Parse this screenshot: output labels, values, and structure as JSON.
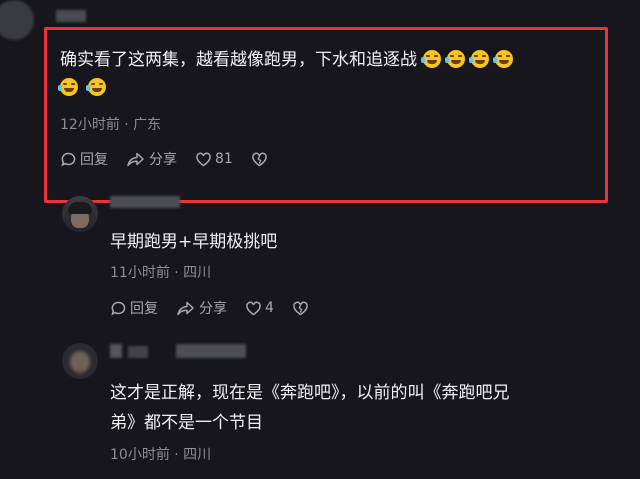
{
  "comments": [
    {
      "text_line1": "确实看了这两集，越看越像跑男，下水和追逐战",
      "meta": "12小时前 · 广东",
      "reply_label": "回复",
      "share_label": "分享",
      "like_count": "81",
      "emoji_count": 6
    },
    {
      "text": "早期跑男+早期极挑吧",
      "meta": "11小时前 · 四川",
      "reply_label": "回复",
      "share_label": "分享",
      "like_count": "4"
    },
    {
      "text_line1": "这才是正解，现在是《奔跑吧》，以前的叫《奔跑吧兄",
      "text_line2": "弟》都不是一个节目",
      "meta": "10小时前 · 四川"
    }
  ],
  "icons": {
    "reply": "reply-icon",
    "share": "share-icon",
    "like": "heart-icon",
    "dislike": "broken-heart-icon",
    "emoji": "laughing-tears-emoji"
  },
  "colors": {
    "background": "#16161c",
    "highlight": "#e8353a",
    "meta": "#8c8c96"
  }
}
